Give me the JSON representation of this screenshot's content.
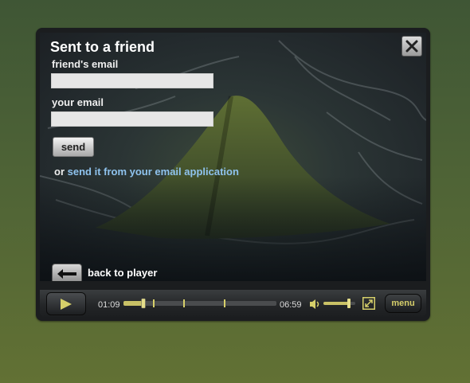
{
  "dialog": {
    "title": "Sent to a friend",
    "friend_email_label": "friend's email",
    "friend_email_value": "",
    "your_email_label": "your email",
    "your_email_value": "",
    "send_label": "send",
    "or_text": "or",
    "link_text": "send it from your email application",
    "back_label": "back to player"
  },
  "controls": {
    "current_time": "01:09",
    "total_time": "06:59",
    "menu_label": "menu",
    "progress_fraction": 0.13,
    "volume_fraction": 0.8
  },
  "icons": {
    "close": "close-icon",
    "back": "back-arrow-icon",
    "play": "play-icon",
    "volume": "volume-icon",
    "fullscreen": "fullscreen-icon"
  },
  "colors": {
    "accent": "#d6cf6a",
    "link": "#8fc3ee"
  }
}
